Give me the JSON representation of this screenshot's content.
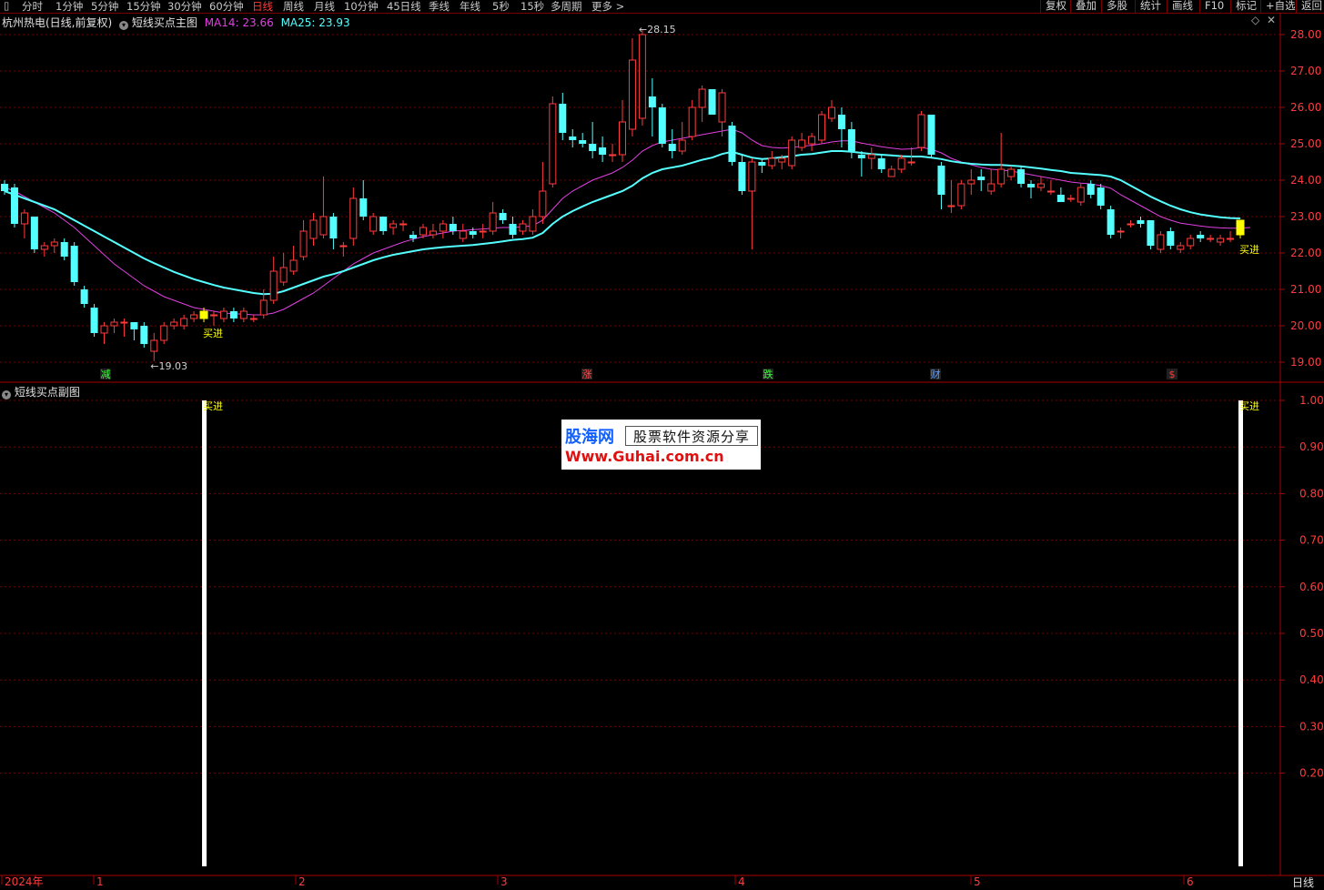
{
  "toolbar": {
    "periods": [
      "分时",
      "1分钟",
      "5分钟",
      "15分钟",
      "30分钟",
      "60分钟",
      "日线",
      "周线",
      "月线",
      "10分钟",
      "45日线",
      "季线",
      "年线",
      "5秒",
      "15秒",
      "多周期",
      "更多 >"
    ],
    "active": "日线",
    "right_buttons": [
      "复权",
      "叠加",
      "多股",
      "统计",
      "画线",
      "F10",
      "标记",
      "+自选",
      "返回"
    ]
  },
  "main_panel": {
    "stock_title": "杭州热电(日线,前复权)",
    "indicator_name": "短线买点主图",
    "ma14": "MA14: 23.66",
    "ma25": "MA25: 23.93",
    "high_label": "28.15",
    "low_label": "19.03",
    "signal_label": "买进",
    "y_ticks": [
      "28.00",
      "27.00",
      "26.00",
      "25.00",
      "24.00",
      "23.00",
      "22.00",
      "21.00",
      "20.00",
      "19.00"
    ],
    "event_markers": [
      "减",
      "涨",
      "跌",
      "财",
      "$"
    ]
  },
  "sub_panel": {
    "indicator_name": "短线买点副图",
    "signal_label": "买进",
    "y_ticks": [
      "1.00",
      "0.90",
      "0.80",
      "0.70",
      "0.60",
      "0.50",
      "0.40",
      "0.30",
      "0.20"
    ]
  },
  "x_axis": {
    "labels": [
      "2024年",
      "1",
      "2",
      "3",
      "4",
      "5",
      "6"
    ],
    "period": "日线"
  },
  "watermark": {
    "line1a": "股海网",
    "line1b": "股票软件资源分享",
    "line2": "Www.Guhai.com.cn"
  },
  "colors": {
    "up": "#ff3b3b",
    "down": "#54ffff",
    "ma14": "#e040e0",
    "ma25": "#54ffff",
    "grid": "#7a0000",
    "signal": "#ffff00"
  },
  "chart_data": {
    "type": "candlestick",
    "ylim": [
      18.6,
      28.4
    ],
    "candles": [
      [
        23.9,
        23.7,
        24.0,
        23.6
      ],
      [
        23.8,
        22.8,
        23.9,
        22.7
      ],
      [
        22.8,
        23.1,
        23.2,
        22.4
      ],
      [
        23.0,
        22.1,
        23.0,
        22.0
      ],
      [
        22.1,
        22.2,
        22.3,
        21.9
      ],
      [
        22.2,
        22.3,
        22.4,
        22.0
      ],
      [
        22.3,
        21.9,
        22.4,
        21.8
      ],
      [
        22.2,
        21.2,
        22.3,
        21.1
      ],
      [
        21.0,
        20.6,
        21.1,
        20.5
      ],
      [
        20.5,
        19.8,
        20.6,
        19.7
      ],
      [
        19.8,
        20.0,
        20.1,
        19.5
      ],
      [
        20.0,
        20.1,
        20.2,
        19.8
      ],
      [
        20.1,
        20.1,
        20.2,
        19.7
      ],
      [
        20.1,
        19.9,
        20.1,
        19.6
      ],
      [
        20.0,
        19.5,
        20.1,
        19.4
      ],
      [
        19.3,
        19.6,
        19.8,
        19.03
      ],
      [
        19.6,
        20.0,
        20.1,
        19.5
      ],
      [
        20.0,
        20.1,
        20.2,
        19.9
      ],
      [
        20.0,
        20.2,
        20.3,
        19.9
      ],
      [
        20.2,
        20.3,
        20.4,
        20.1
      ],
      [
        20.4,
        20.2,
        20.5,
        20.1
      ],
      [
        20.3,
        20.3,
        20.4,
        20.0
      ],
      [
        20.2,
        20.4,
        20.5,
        20.1
      ],
      [
        20.4,
        20.2,
        20.5,
        20.1
      ],
      [
        20.2,
        20.4,
        20.5,
        20.1
      ],
      [
        20.2,
        20.2,
        20.3,
        20.1
      ],
      [
        20.3,
        20.7,
        21.0,
        20.2
      ],
      [
        20.7,
        21.5,
        21.9,
        20.6
      ],
      [
        21.2,
        21.6,
        22.0,
        21.1
      ],
      [
        21.5,
        21.8,
        22.2,
        21.4
      ],
      [
        21.9,
        22.6,
        22.9,
        21.8
      ],
      [
        22.4,
        22.9,
        23.1,
        22.2
      ],
      [
        22.5,
        23.0,
        24.1,
        22.4
      ],
      [
        23.0,
        22.4,
        23.1,
        22.1
      ],
      [
        22.2,
        22.2,
        22.3,
        21.9
      ],
      [
        22.4,
        23.5,
        23.8,
        22.2
      ],
      [
        23.5,
        23.0,
        24.0,
        22.9
      ],
      [
        22.6,
        23.0,
        23.1,
        22.5
      ],
      [
        23.0,
        22.6,
        23.0,
        22.5
      ],
      [
        22.7,
        22.8,
        22.9,
        22.5
      ],
      [
        22.8,
        22.8,
        22.9,
        22.6
      ],
      [
        22.5,
        22.4,
        22.6,
        22.3
      ],
      [
        22.5,
        22.7,
        22.8,
        22.4
      ],
      [
        22.5,
        22.6,
        22.8,
        22.4
      ],
      [
        22.6,
        22.8,
        22.9,
        22.4
      ],
      [
        22.8,
        22.6,
        23.0,
        22.5
      ],
      [
        22.4,
        22.6,
        22.8,
        22.3
      ],
      [
        22.6,
        22.5,
        22.7,
        22.4
      ],
      [
        22.6,
        22.6,
        22.8,
        22.4
      ],
      [
        22.6,
        23.1,
        23.4,
        22.5
      ],
      [
        23.1,
        22.9,
        23.2,
        22.8
      ],
      [
        22.8,
        22.5,
        23.0,
        22.4
      ],
      [
        22.6,
        22.8,
        22.9,
        22.5
      ],
      [
        22.6,
        23.0,
        23.2,
        22.5
      ],
      [
        23.0,
        23.7,
        24.5,
        22.8
      ],
      [
        23.9,
        26.1,
        26.3,
        23.8
      ],
      [
        26.1,
        25.3,
        26.4,
        25.1
      ],
      [
        25.2,
        25.1,
        25.4,
        24.9
      ],
      [
        25.1,
        25.0,
        25.3,
        24.9
      ],
      [
        25.0,
        24.8,
        25.6,
        24.6
      ],
      [
        24.9,
        24.7,
        25.2,
        24.5
      ],
      [
        24.7,
        24.7,
        25.0,
        24.5
      ],
      [
        24.7,
        25.6,
        26.2,
        24.5
      ],
      [
        25.4,
        27.3,
        27.9,
        25.2
      ],
      [
        25.7,
        28.0,
        28.15,
        25.5
      ],
      [
        26.3,
        26.0,
        26.8,
        25.2
      ],
      [
        26.0,
        25.0,
        26.1,
        24.9
      ],
      [
        25.0,
        24.8,
        25.4,
        24.6
      ],
      [
        24.8,
        25.1,
        25.6,
        24.7
      ],
      [
        25.2,
        26.0,
        26.2,
        25.1
      ],
      [
        26.0,
        26.5,
        26.6,
        25.6
      ],
      [
        26.5,
        25.8,
        26.5,
        25.8
      ],
      [
        25.6,
        26.4,
        26.5,
        25.2
      ],
      [
        25.5,
        24.5,
        25.6,
        24.4
      ],
      [
        24.5,
        23.7,
        24.7,
        23.6
      ],
      [
        23.7,
        24.5,
        24.6,
        22.1
      ],
      [
        24.5,
        24.4,
        24.6,
        24.2
      ],
      [
        24.4,
        24.6,
        24.8,
        24.3
      ],
      [
        24.5,
        24.6,
        24.7,
        24.3
      ],
      [
        24.4,
        25.1,
        25.2,
        24.3
      ],
      [
        24.9,
        25.1,
        25.3,
        24.8
      ],
      [
        25.0,
        25.2,
        25.3,
        24.8
      ],
      [
        25.1,
        25.8,
        25.9,
        25.0
      ],
      [
        25.7,
        26.0,
        26.2,
        25.6
      ],
      [
        25.8,
        25.4,
        26.0,
        24.9
      ],
      [
        25.4,
        24.8,
        25.6,
        24.6
      ],
      [
        24.7,
        24.6,
        24.8,
        24.1
      ],
      [
        24.6,
        24.7,
        24.9,
        24.3
      ],
      [
        24.6,
        24.3,
        24.7,
        24.2
      ],
      [
        24.1,
        24.3,
        24.4,
        24.1
      ],
      [
        24.3,
        24.6,
        24.7,
        24.2
      ],
      [
        24.5,
        24.5,
        24.9,
        24.4
      ],
      [
        24.9,
        25.8,
        25.9,
        24.8
      ],
      [
        25.8,
        24.7,
        25.8,
        24.6
      ],
      [
        24.4,
        23.6,
        24.5,
        23.2
      ],
      [
        23.3,
        23.3,
        24.0,
        23.1
      ],
      [
        23.3,
        23.9,
        24.0,
        23.2
      ],
      [
        23.9,
        24.0,
        24.3,
        23.6
      ],
      [
        24.1,
        24.0,
        24.3,
        23.7
      ],
      [
        23.7,
        23.9,
        24.3,
        23.6
      ],
      [
        23.9,
        24.3,
        25.3,
        23.8
      ],
      [
        24.1,
        24.3,
        24.4,
        24.0
      ],
      [
        24.3,
        23.9,
        24.4,
        23.8
      ],
      [
        23.9,
        23.8,
        24.0,
        23.5
      ],
      [
        23.8,
        23.9,
        24.1,
        23.7
      ],
      [
        23.7,
        23.7,
        24.0,
        23.6
      ],
      [
        23.6,
        23.4,
        23.8,
        23.4
      ],
      [
        23.5,
        23.5,
        23.6,
        23.4
      ],
      [
        23.4,
        23.8,
        23.9,
        23.3
      ],
      [
        23.9,
        23.6,
        24.0,
        23.5
      ],
      [
        23.8,
        23.3,
        23.9,
        23.2
      ],
      [
        23.2,
        22.5,
        23.3,
        22.4
      ],
      [
        22.6,
        22.6,
        22.7,
        22.4
      ],
      [
        22.8,
        22.8,
        22.9,
        22.7
      ],
      [
        22.9,
        22.8,
        23.0,
        22.7
      ],
      [
        22.9,
        22.2,
        22.9,
        22.1
      ],
      [
        22.1,
        22.5,
        22.6,
        22.0
      ],
      [
        22.6,
        22.2,
        22.7,
        22.1
      ],
      [
        22.1,
        22.2,
        22.3,
        22.0
      ],
      [
        22.2,
        22.4,
        22.5,
        22.1
      ],
      [
        22.5,
        22.4,
        22.6,
        22.3
      ],
      [
        22.4,
        22.4,
        22.5,
        22.3
      ],
      [
        22.3,
        22.4,
        22.5,
        22.2
      ],
      [
        22.4,
        22.4,
        22.6,
        22.3
      ],
      [
        22.5,
        22.9,
        22.9,
        22.4
      ]
    ],
    "ma14": [
      23.8,
      23.7,
      23.55,
      23.4,
      23.25,
      23.1,
      22.9,
      22.7,
      22.45,
      22.2,
      21.95,
      21.7,
      21.5,
      21.3,
      21.1,
      20.95,
      20.8,
      20.7,
      20.6,
      20.5,
      20.45,
      20.4,
      20.35,
      20.33,
      20.32,
      20.3,
      20.3,
      20.35,
      20.45,
      20.6,
      20.75,
      20.9,
      21.1,
      21.3,
      21.5,
      21.7,
      21.85,
      22.0,
      22.1,
      22.2,
      22.3,
      22.38,
      22.45,
      22.5,
      22.55,
      22.6,
      22.62,
      22.64,
      22.66,
      22.68,
      22.7,
      22.7,
      22.72,
      22.75,
      22.9,
      23.2,
      23.5,
      23.7,
      23.85,
      24.0,
      24.1,
      24.2,
      24.35,
      24.55,
      24.8,
      24.95,
      25.05,
      25.1,
      25.15,
      25.2,
      25.25,
      25.3,
      25.35,
      25.4,
      25.3,
      25.1,
      24.95,
      24.9,
      24.88,
      24.9,
      24.93,
      24.96,
      25.0,
      25.05,
      25.08,
      25.08,
      25.02,
      24.97,
      24.92,
      24.88,
      24.85,
      24.86,
      24.9,
      24.85,
      24.75,
      24.6,
      24.5,
      24.42,
      24.35,
      24.3,
      24.28,
      24.25,
      24.2,
      24.15,
      24.1,
      24.05,
      24.0,
      23.95,
      23.92,
      23.9,
      23.85,
      23.78,
      23.6,
      23.45,
      23.3,
      23.15,
      23.0,
      22.9,
      22.82,
      22.78,
      22.74,
      22.71,
      22.69,
      22.68,
      22.68,
      22.7
    ],
    "ma25": [
      23.7,
      23.6,
      23.5,
      23.4,
      23.3,
      23.2,
      23.05,
      22.9,
      22.75,
      22.6,
      22.45,
      22.3,
      22.15,
      22.0,
      21.85,
      21.72,
      21.6,
      21.48,
      21.38,
      21.28,
      21.2,
      21.12,
      21.05,
      21.0,
      20.95,
      20.9,
      20.87,
      20.88,
      20.95,
      21.05,
      21.15,
      21.25,
      21.35,
      21.42,
      21.5,
      21.6,
      21.7,
      21.8,
      21.88,
      21.95,
      22.0,
      22.05,
      22.1,
      22.13,
      22.16,
      22.18,
      22.2,
      22.22,
      22.25,
      22.28,
      22.32,
      22.36,
      22.38,
      22.42,
      22.55,
      22.8,
      23.0,
      23.15,
      23.28,
      23.4,
      23.5,
      23.6,
      23.7,
      23.85,
      24.05,
      24.2,
      24.3,
      24.35,
      24.4,
      24.48,
      24.56,
      24.62,
      24.72,
      24.78,
      24.7,
      24.62,
      24.58,
      24.6,
      24.63,
      24.66,
      24.7,
      24.72,
      24.76,
      24.8,
      24.8,
      24.78,
      24.75,
      24.72,
      24.7,
      24.68,
      24.66,
      24.65,
      24.65,
      24.62,
      24.58,
      24.52,
      24.48,
      24.45,
      24.43,
      24.42,
      24.42,
      24.4,
      24.38,
      24.35,
      24.32,
      24.28,
      24.25,
      24.2,
      24.18,
      24.16,
      24.14,
      24.1,
      24.0,
      23.85,
      23.7,
      23.55,
      23.42,
      23.3,
      23.2,
      23.12,
      23.06,
      23.02,
      22.98,
      22.96,
      22.95
    ],
    "signals": [
      20,
      124
    ]
  }
}
